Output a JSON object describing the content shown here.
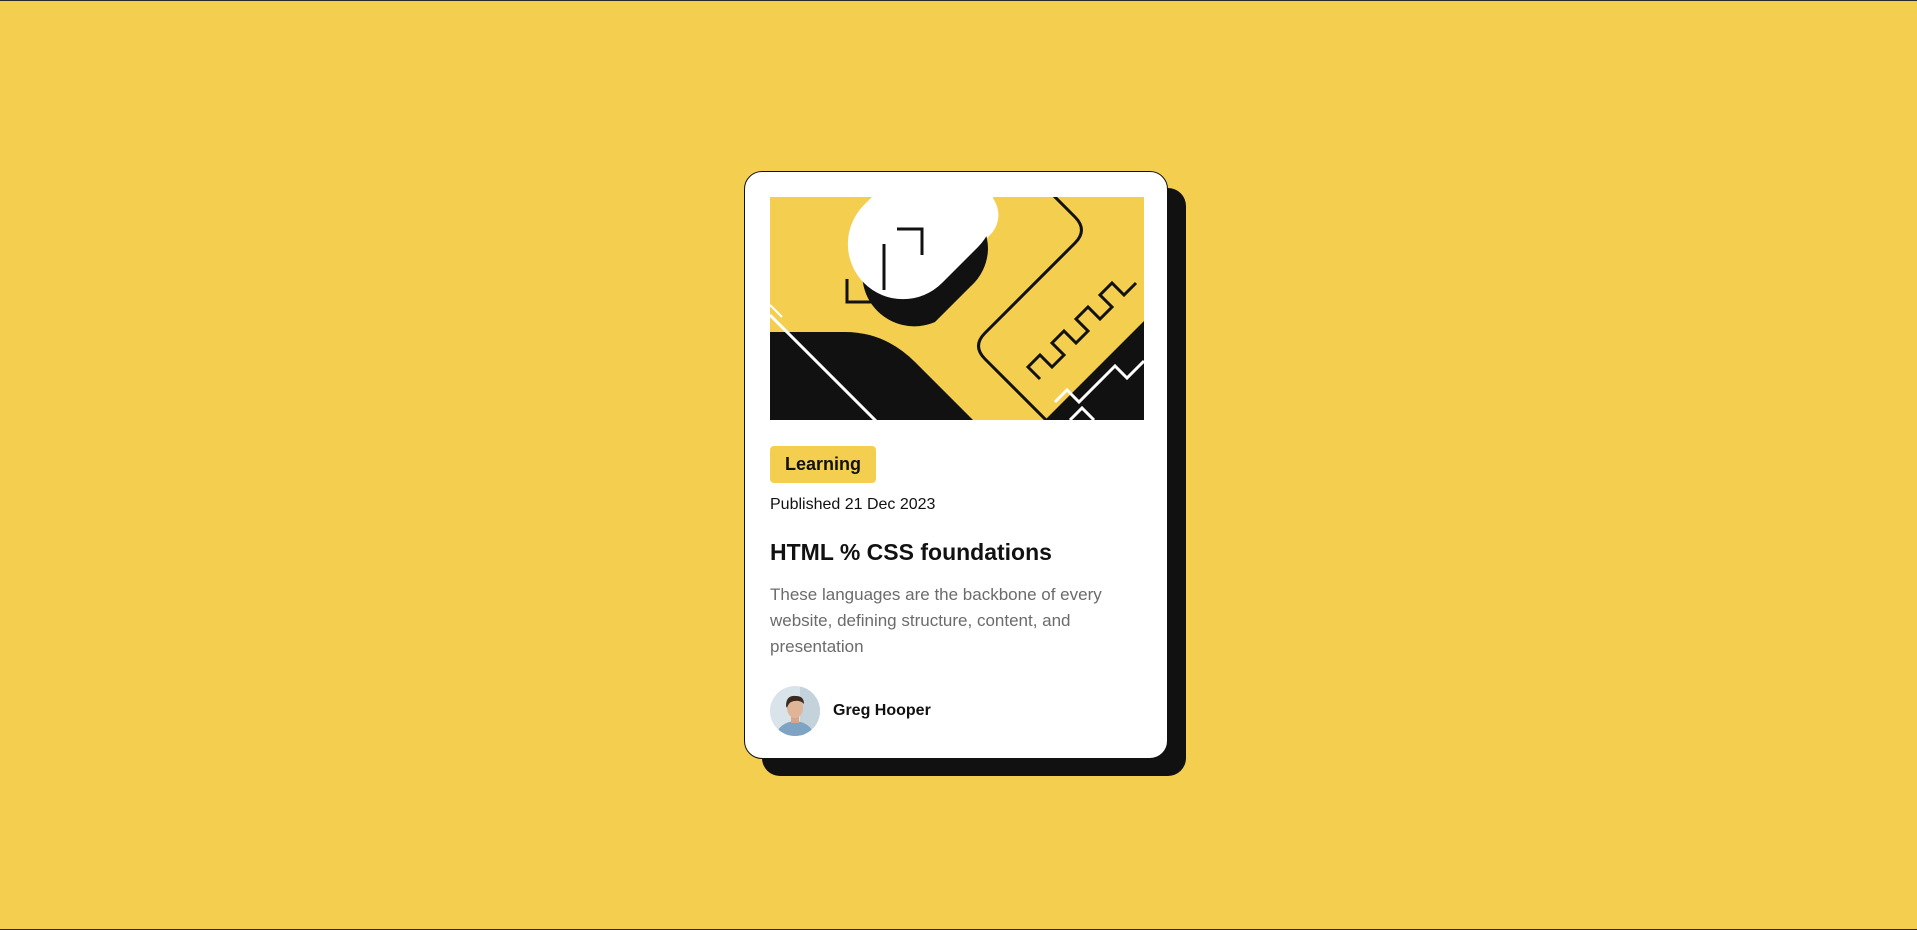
{
  "card": {
    "tag": "Learning",
    "published": "Published 21 Dec 2023",
    "title": "HTML % CSS foundations",
    "description": "These languages are the backbone of every website, defining structure, content, and presentation",
    "author": {
      "name": "Greg Hooper"
    }
  },
  "colors": {
    "background": "#f4cf4f",
    "card": "#ffffff",
    "ink": "#111111",
    "muted_text": "#6b6b6b"
  },
  "icons": {
    "hero": "abstract-illustration",
    "avatar": "person-photo"
  }
}
